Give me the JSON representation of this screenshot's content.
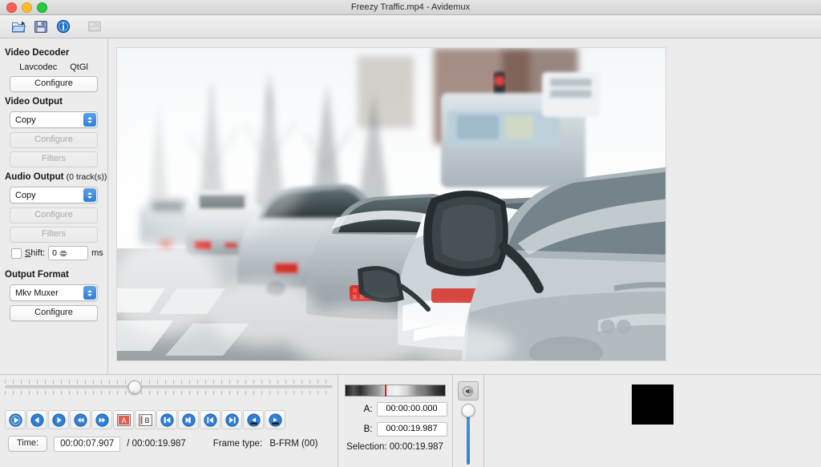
{
  "window": {
    "title": "Freezy Traffic.mp4 - Avidemux",
    "controls": {
      "close": "close",
      "minimize": "minimize",
      "maximize": "maximize"
    }
  },
  "toolbar": {
    "items": [
      {
        "name": "open-file-icon",
        "label": "Open",
        "enabled": true
      },
      {
        "name": "save-file-icon",
        "label": "Save",
        "enabled": true
      },
      {
        "name": "info-icon",
        "label": "Information",
        "enabled": true
      },
      {
        "name": "calculator-icon",
        "label": "Bitrate Calculator",
        "enabled": false
      }
    ]
  },
  "sidebar": {
    "video_decoder": {
      "title": "Video Decoder",
      "codec": "Lavcodec",
      "renderer": "QtGl",
      "configure_label": "Configure"
    },
    "video_output": {
      "title": "Video Output",
      "mode": "Copy",
      "configure_label": "Configure",
      "filters_label": "Filters"
    },
    "audio_output": {
      "title": "Audio Output",
      "track_count": "(0 track(s))",
      "mode": "Copy",
      "configure_label": "Configure",
      "filters_label": "Filters",
      "shift_label": "Shift:",
      "shift_value": "0",
      "shift_unit": "ms",
      "shift_enabled": false
    },
    "output_format": {
      "title": "Output Format",
      "muxer": "Mkv Muxer",
      "configure_label": "Configure"
    }
  },
  "preview": {
    "description": "Winter traffic queue of snow covered cars on a city street"
  },
  "transport": {
    "scrub_percent": 39.6,
    "buttons": [
      {
        "name": "play-button",
        "label": "Play"
      },
      {
        "name": "previous-frame-button",
        "label": "Previous frame"
      },
      {
        "name": "next-frame-button",
        "label": "Next frame"
      },
      {
        "name": "rewind-button",
        "label": "Rewind"
      },
      {
        "name": "forward-button",
        "label": "Forward"
      },
      {
        "name": "mark-a-button",
        "label": "A"
      },
      {
        "name": "mark-b-button",
        "label": "B"
      },
      {
        "name": "go-to-start-button",
        "label": "Go to start"
      },
      {
        "name": "go-to-end-button",
        "label": "Go to end"
      },
      {
        "name": "previous-keyframe-button",
        "label": "Previous keyframe"
      },
      {
        "name": "next-keyframe-button",
        "label": "Next keyframe"
      },
      {
        "name": "previous-blackframe-button",
        "label": "Previous black frame"
      },
      {
        "name": "next-blackframe-button",
        "label": "Next black frame"
      }
    ],
    "time_label": "Time:",
    "current_time": "00:00:07.907",
    "total_time": "/ 00:00:19.987",
    "frame_type_label": "Frame type:",
    "frame_type_value": "B-FRM (00)"
  },
  "selection": {
    "marker_percent": 40,
    "a_label": "A:",
    "a_value": "00:00:00.000",
    "b_label": "B:",
    "b_value": "00:00:19.987",
    "selection_text": "Selection: 00:00:19.987"
  },
  "volume": {
    "button_name": "volume-icon",
    "level_percent": 100
  },
  "colors": {
    "accent": "#3c7fd0",
    "marker": "#e02020",
    "window_bg": "#ececec"
  }
}
